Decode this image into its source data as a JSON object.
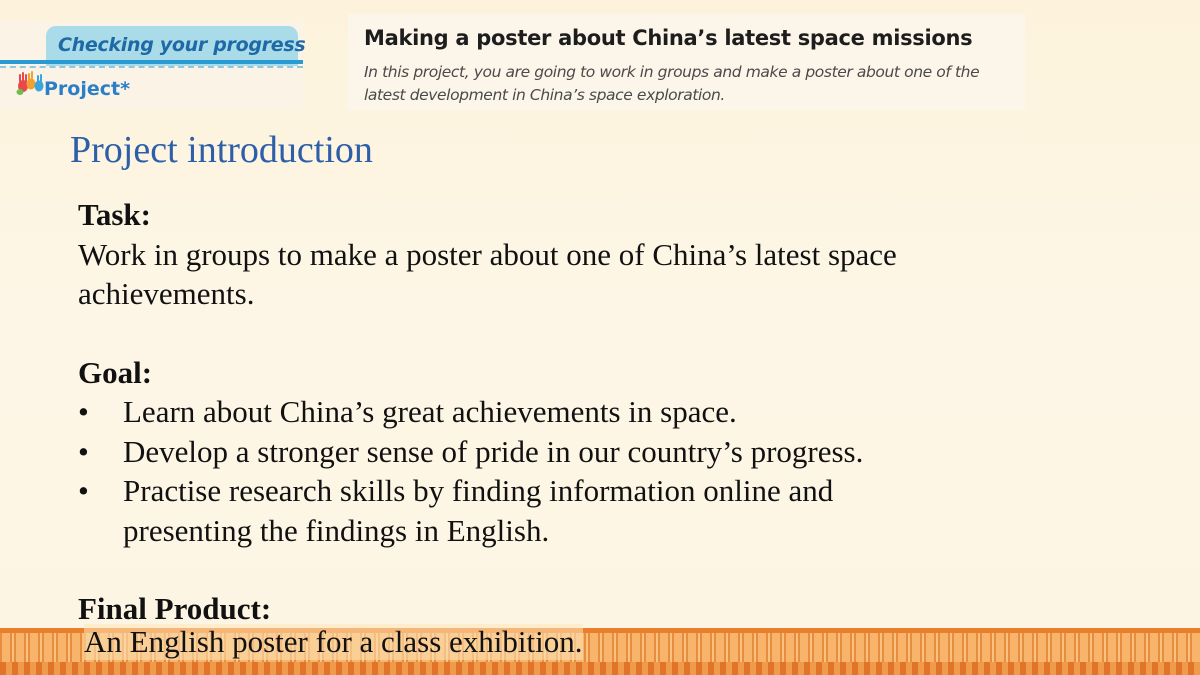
{
  "badge": {
    "progress_label": "Checking your progress",
    "project_label": "Project*",
    "icon": "hands-icon"
  },
  "header": {
    "title": "Making a poster about China’s latest space missions",
    "description": "In this project, you are going to work in groups and make a poster about one of the latest development in China’s space exploration."
  },
  "intro": {
    "heading": "Project introduction"
  },
  "task": {
    "label": "Task:",
    "text_line1": "Work in groups to make a poster about one of China’s latest space",
    "text_line2": "achievements."
  },
  "goal": {
    "label": "Goal:",
    "bullet_glyph": "•",
    "items": [
      {
        "line1": "Learn about China’s great achievements in space."
      },
      {
        "line1": "Develop a stronger sense of pride in our country’s progress."
      },
      {
        "line1": "Practise research skills by finding information online and",
        "line2": "presenting the findings in English."
      }
    ]
  },
  "final_product": {
    "label": "Final Product:",
    "text": "An English poster for a class exhibition."
  },
  "colors": {
    "heading_blue": "#2d5fa8",
    "tab_blue": "#1f6aa6",
    "border_orange": "#e97f2c"
  }
}
